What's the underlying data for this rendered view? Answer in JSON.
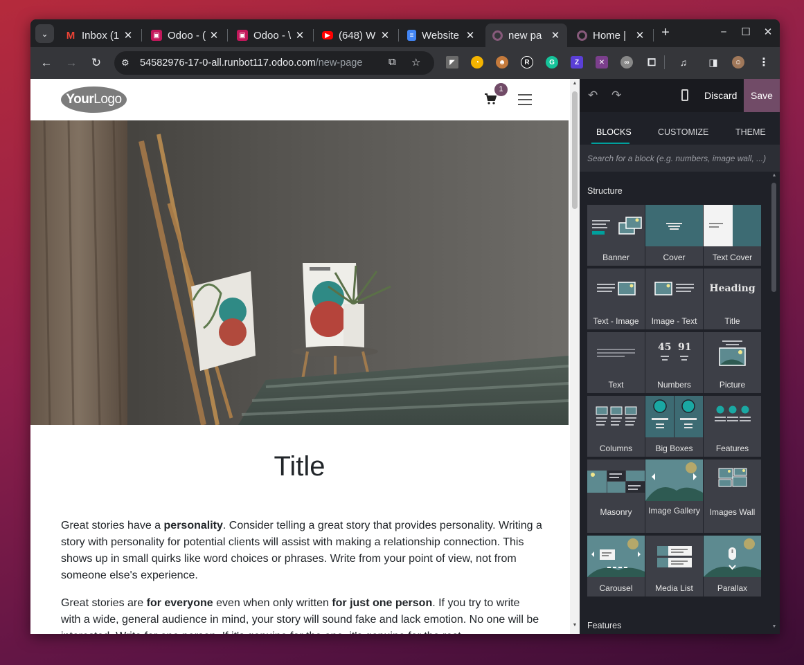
{
  "browser": {
    "tabs": [
      {
        "title": "Inbox (1",
        "favicon": "gmail-icon",
        "color": "#ea4335"
      },
      {
        "title": "Odoo - (",
        "favicon": "odoo-runbot-icon",
        "color": "#c2185b"
      },
      {
        "title": "Odoo - \\",
        "favicon": "odoo-runbot-icon",
        "color": "#c2185b"
      },
      {
        "title": "(648) W",
        "favicon": "youtube-icon",
        "color": "#ff0000"
      },
      {
        "title": "Website",
        "favicon": "docs-icon",
        "color": "#4285f4"
      },
      {
        "title": "new pa",
        "favicon": "odoo-icon",
        "color": "#875a7b",
        "active": true
      },
      {
        "title": "Home |",
        "favicon": "odoo-icon",
        "color": "#875a7b"
      }
    ],
    "url_host": "54582976-17-0-all.runbot117.odoo.com",
    "url_path": "/new-page",
    "extensions": [
      "feedly-icon",
      "clock-extension-icon",
      "avatar-extension-icon",
      "registered-icon",
      "grammarly-icon",
      "z-extension-icon",
      "x-extension-icon",
      "mask-extension-icon",
      "puzzle-icon",
      "media-control-icon",
      "sidebar-icon",
      "profile-avatar",
      "menu-dots-icon"
    ]
  },
  "site": {
    "logo_bold": "Your",
    "logo_light": "Logo",
    "cart_count": "1",
    "title": "Title",
    "p1_a": "Great stories have a ",
    "p1_b": "personality",
    "p1_c": ". Consider telling a great story that provides personality. Writing a story with personality for potential clients will assist with making a relationship connection. This shows up in small quirks like word choices or phrases. Write from your point of view, not from someone else's experience.",
    "p2_a": "Great stories are ",
    "p2_b": "for everyone",
    "p2_c": " even when only written ",
    "p2_d": "for just one person",
    "p2_e": ". If you try to write with a wide, general audience in mind, your story will sound fake and lack emotion. No one will be interested. Write for one person. If it's genuine for the one, it's genuine for the rest."
  },
  "editor": {
    "discard": "Discard",
    "save": "Save",
    "tabs": [
      "BLOCKS",
      "CUSTOMIZE",
      "THEME"
    ],
    "search_placeholder": "Search for a block (e.g. numbers, image wall, ...)",
    "section_structure": "Structure",
    "section_features": "Features",
    "blocks": [
      "Banner",
      "Cover",
      "Text Cover",
      "Text - Image",
      "Image - Text",
      "Title",
      "Text",
      "Numbers",
      "Picture",
      "Columns",
      "Big Boxes",
      "Features",
      "Masonry",
      "Image Gallery",
      "Images Wall",
      "Carousel",
      "Media List",
      "Parallax"
    ],
    "title_thumb": "Heading",
    "numbers_thumb": [
      "45",
      "91"
    ],
    "accent": "#714b67",
    "teal": "#3d6b73"
  }
}
